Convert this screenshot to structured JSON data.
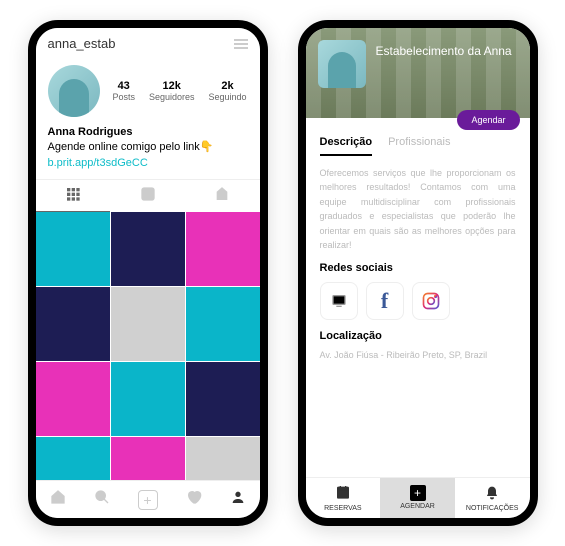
{
  "left": {
    "username": "anna_estab",
    "stats": {
      "posts": {
        "num": "43",
        "label": "Posts"
      },
      "followers": {
        "num": "12k",
        "label": "Seguidores"
      },
      "following": {
        "num": "2k",
        "label": "Seguindo"
      }
    },
    "bio": {
      "name": "Anna Rodrigues",
      "text": "Agende online comigo pelo link👇",
      "link": "b.prit.app/t3sdGeCC"
    },
    "grid_colors": [
      "teal",
      "navy",
      "pink",
      "navy",
      "gray",
      "teal",
      "pink",
      "teal",
      "navy",
      "teal",
      "pink",
      "gray"
    ]
  },
  "right": {
    "title": "Estabelecimento da Anna",
    "agendar_btn": "Agendar",
    "tabs": {
      "desc": "Descrição",
      "prof": "Profissionais"
    },
    "description": "Oferecemos serviços que lhe proporcionam os melhores resultados! Contamos com uma equipe multidisciplinar com profissionais graduados e especialistas que poderão lhe orientar em quais são as melhores opções para realizar!",
    "social_title": "Redes sociais",
    "location_title": "Localização",
    "address": "Av. João Fiúsa - Ribeirão Preto, SP, Brazil",
    "nav": {
      "reservas": "RESERVAS",
      "agendar": "AGENDAR",
      "notif": "NOTIFICAÇÕES"
    }
  }
}
